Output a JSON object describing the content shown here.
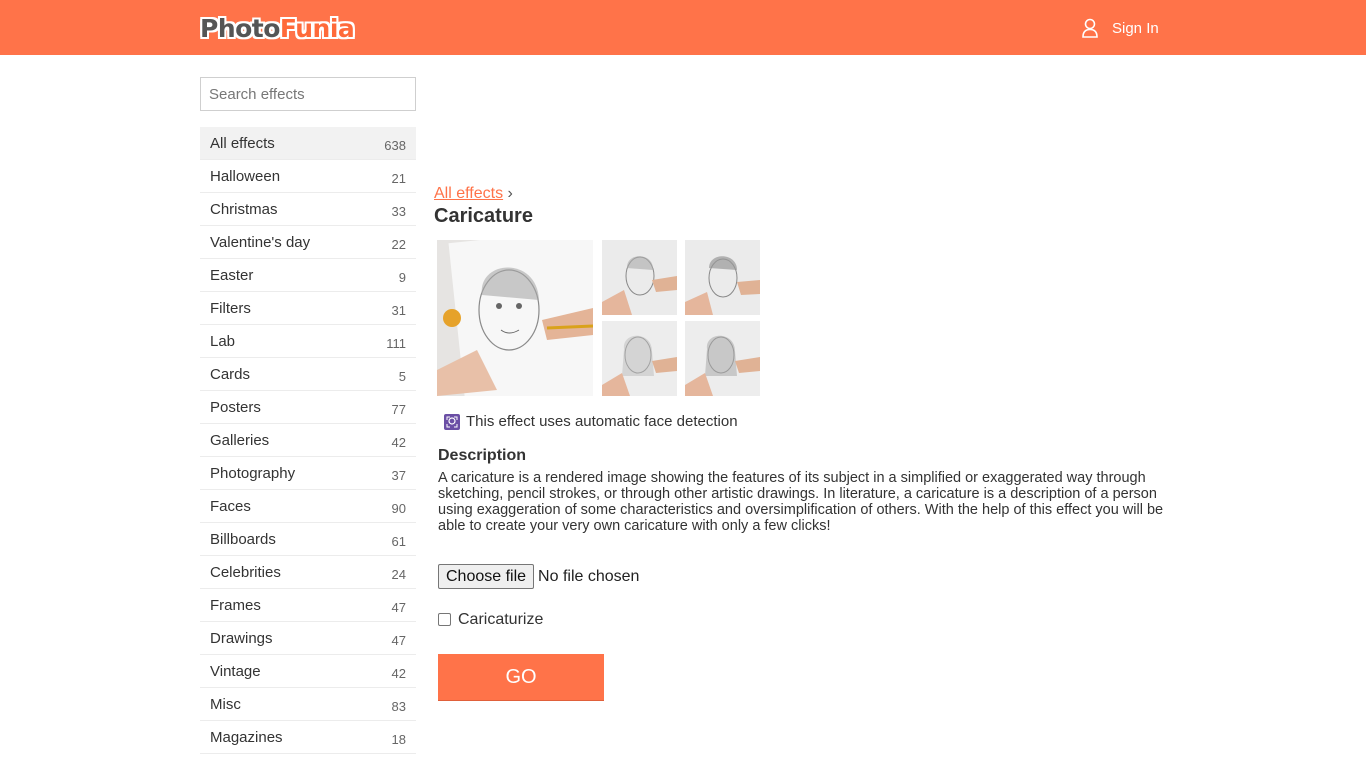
{
  "brand": {
    "logo_part1": "Photo",
    "logo_part2": "Funia",
    "accent": "#ff7349"
  },
  "header": {
    "signin_label": "Sign In",
    "signin_icon": "user-icon"
  },
  "search": {
    "placeholder": "Search effects",
    "value": ""
  },
  "categories": [
    {
      "label": "All effects",
      "count": "638",
      "active": true
    },
    {
      "label": "Halloween",
      "count": "21"
    },
    {
      "label": "Christmas",
      "count": "33"
    },
    {
      "label": "Valentine's day",
      "count": "22"
    },
    {
      "label": "Easter",
      "count": "9"
    },
    {
      "label": "Filters",
      "count": "31"
    },
    {
      "label": "Lab",
      "count": "111"
    },
    {
      "label": "Cards",
      "count": "5"
    },
    {
      "label": "Posters",
      "count": "77"
    },
    {
      "label": "Galleries",
      "count": "42"
    },
    {
      "label": "Photography",
      "count": "37"
    },
    {
      "label": "Faces",
      "count": "90"
    },
    {
      "label": "Billboards",
      "count": "61"
    },
    {
      "label": "Celebrities",
      "count": "24"
    },
    {
      "label": "Frames",
      "count": "47"
    },
    {
      "label": "Drawings",
      "count": "47"
    },
    {
      "label": "Vintage",
      "count": "42"
    },
    {
      "label": "Misc",
      "count": "83"
    },
    {
      "label": "Magazines",
      "count": "18"
    }
  ],
  "breadcrumb": {
    "link": "All effects",
    "separator": "›"
  },
  "effect": {
    "title": "Caricature",
    "face_detection_note": "This effect uses automatic face detection",
    "description_heading": "Description",
    "description": "A caricature is a rendered image showing the features of its subject in a simplified or exaggerated way through sketching, pencil strokes, or through other artistic drawings. In literature, a caricature is a description of a person using exaggeration of some characteristics and oversimplification of others. With the help of this effect you will be able to create your very own caricature with only a few clicks!"
  },
  "form": {
    "file_button": "Choose file",
    "file_status": "No file chosen",
    "checkbox_label": "Caricaturize",
    "checkbox_checked": false,
    "submit_label": "GO"
  }
}
